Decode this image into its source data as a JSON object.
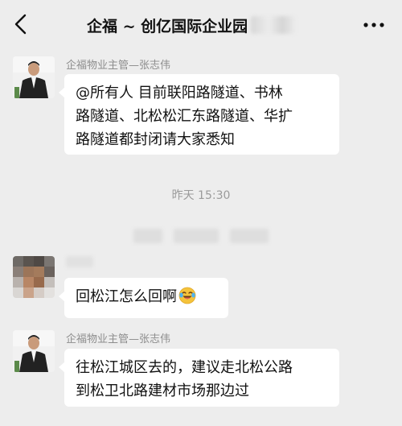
{
  "header": {
    "title": "企福 ~ 创亿国际企业园",
    "back_icon": "chevron-left-icon",
    "more_icon": "more-dots-icon"
  },
  "messages": [
    {
      "sender": "企福物业主管—张志伟",
      "lines": [
        "@所有人  目前联阳路隧道、书林",
        "路隧道、北松松汇东路隧道、华扩",
        "路隧道都封闭请大家悉知"
      ]
    },
    {
      "sender": "",
      "lines": [
        "回松江怎么回啊"
      ],
      "emoji": "laughing-crying-emoji"
    },
    {
      "sender": "企福物业主管—张志伟",
      "lines": [
        "往松江城区去的，建议走北松公路",
        "到松卫北路建材市场那边过"
      ]
    }
  ],
  "timestamp": "昨天 15:30",
  "colors": {
    "background": "#ededed",
    "bubble": "#ffffff",
    "sender_text": "#8d8d8d",
    "timestamp_text": "#9b9b9b"
  }
}
